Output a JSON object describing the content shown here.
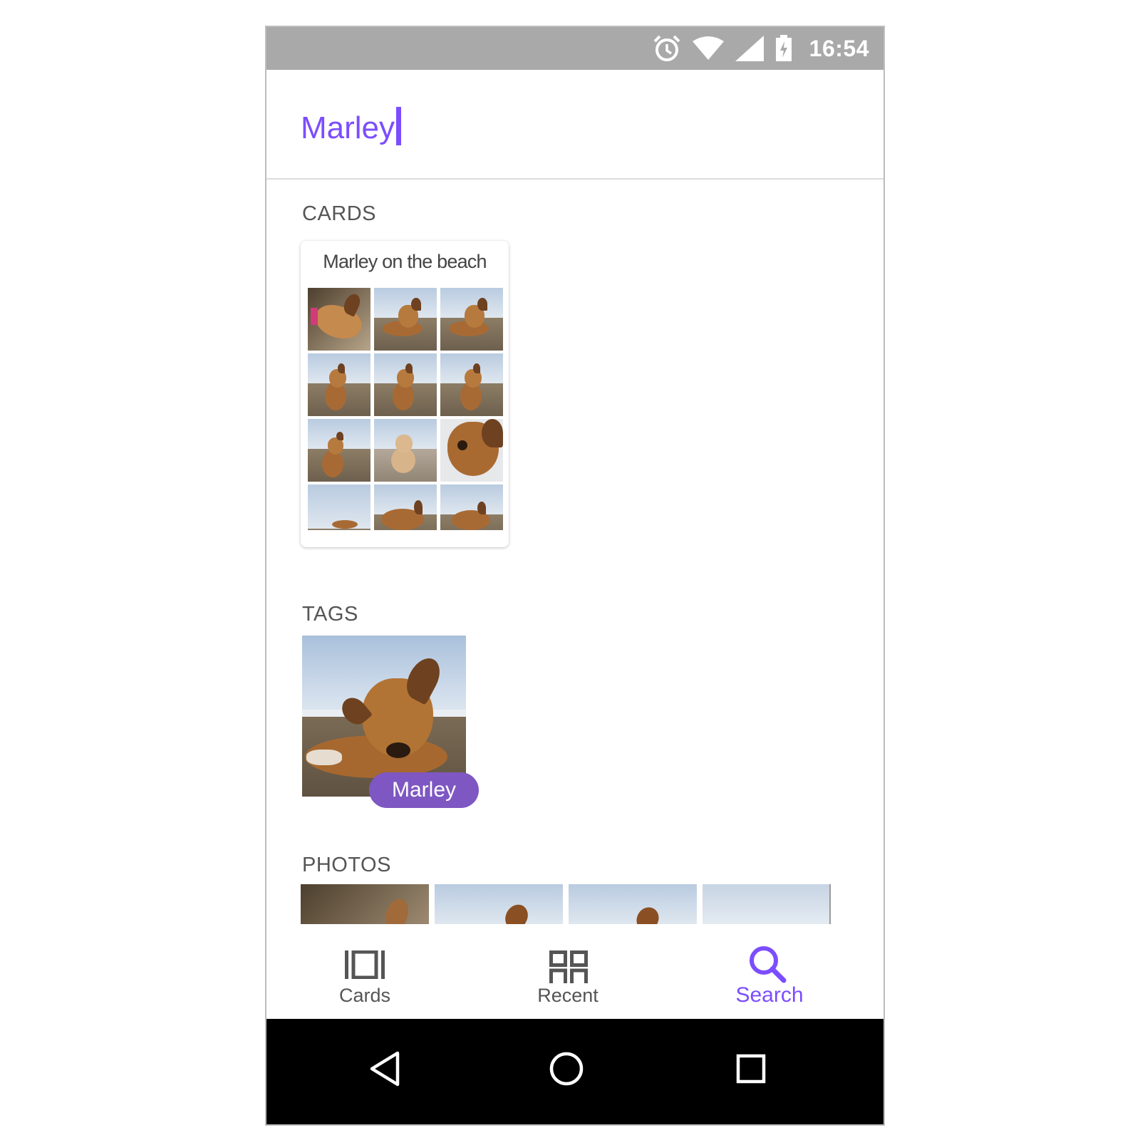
{
  "status_bar": {
    "time": "16:54"
  },
  "search": {
    "query": "Marley"
  },
  "sections": {
    "cards": "CARDS",
    "tags": "TAGS",
    "photos": "PHOTOS"
  },
  "card": {
    "title": "Marley on the beach"
  },
  "tag": {
    "label": "Marley"
  },
  "bottom_nav": [
    {
      "label": "Cards",
      "icon": "cards-icon",
      "active": false
    },
    {
      "label": "Recent",
      "icon": "grid-icon",
      "active": false
    },
    {
      "label": "Search",
      "icon": "search-icon",
      "active": true
    }
  ],
  "colors": {
    "accent": "#7c4dff",
    "chip": "#7e57c2",
    "status_bar": "#a9a9a9",
    "system_nav": "#000000"
  }
}
